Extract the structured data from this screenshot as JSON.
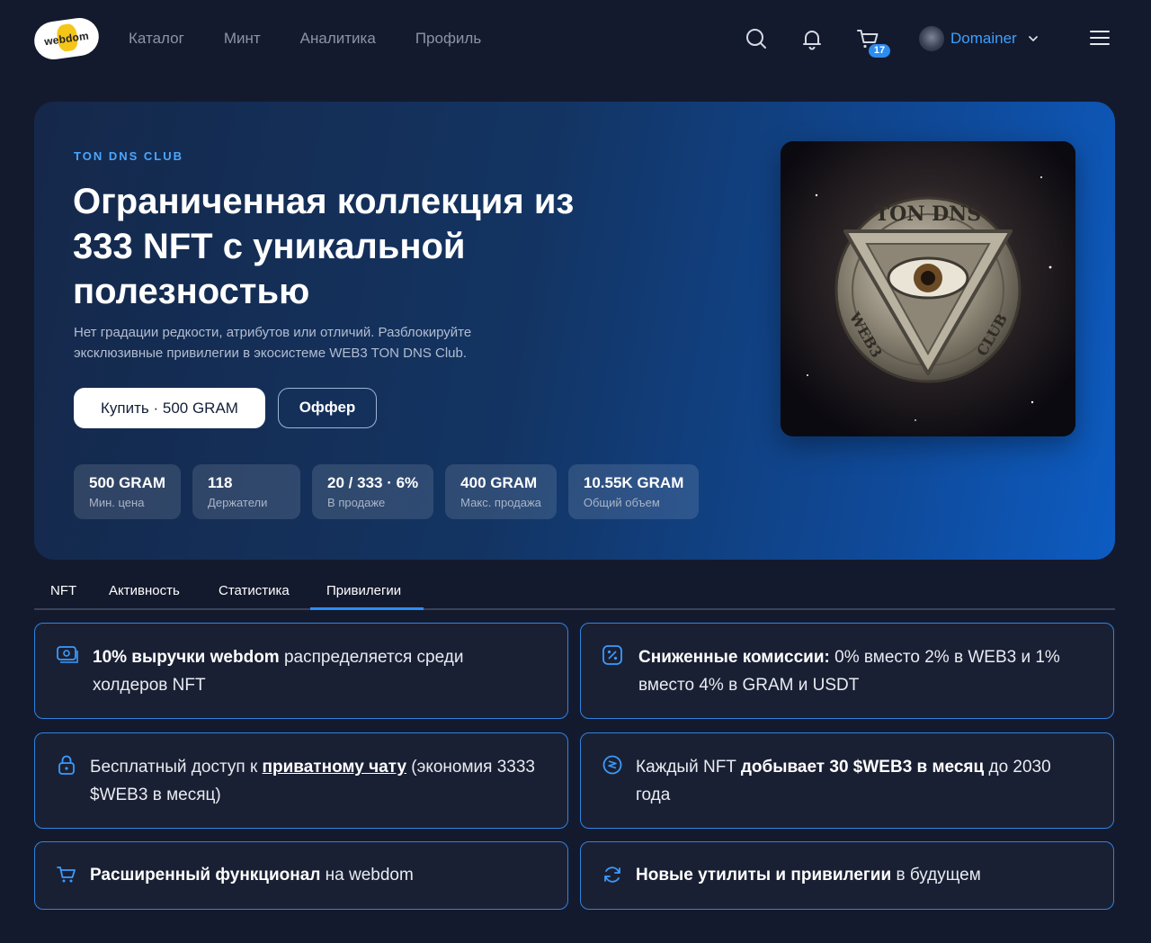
{
  "header": {
    "logo_text": "webdom",
    "nav": [
      "Каталог",
      "Минт",
      "Аналитика",
      "Профиль"
    ],
    "cart_count": "17",
    "user_name": "Domainer",
    "icons": [
      "search-icon",
      "bell-icon",
      "cart-icon",
      "chevron-down-icon",
      "menu-icon"
    ]
  },
  "hero": {
    "eyebrow": "TON DNS CLUB",
    "title": "Ограниченная коллекция из 333 NFT с уникальной полезностью",
    "subtitle": "Нет градации редкости, атрибутов или отличий. Разблокируйте эксклюзивные привилегии в экосистеме WEB3 TON DNS Club.",
    "buy_label": "Купить · 500 GRAM",
    "offer_label": "Оффер",
    "image_text_top": "TON DNS",
    "image_text_left": "WEB3",
    "image_text_right": "CLUB",
    "stats": [
      {
        "value": "500 GRAM",
        "label": "Мин. цена"
      },
      {
        "value": "118",
        "label": "Держатели"
      },
      {
        "value": "20 / 333 · 6%",
        "label": "В продаже"
      },
      {
        "value": "400 GRAM",
        "label": "Макс. продажа"
      },
      {
        "value": "10.55K GRAM",
        "label": "Общий объем"
      }
    ]
  },
  "tabs": [
    "NFT",
    "Активность",
    "Статистика",
    "Привилегии"
  ],
  "active_tab": "Привилегии",
  "privileges": {
    "revenue": {
      "bold": "10% выручки webdom",
      "rest": " распределяется среди холдеров NFT",
      "icon": "money-icon"
    },
    "fees": {
      "bold": "Сниженные комиссии:",
      "rest": " 0% вместо 2% в WEB3 и 1% вместо 4% в GRAM и USDT",
      "icon": "percent-icon"
    },
    "chat": {
      "pre": "Бесплатный доступ к ",
      "link": "приватному чату",
      "rest": " (экономия 3333 $WEB3 в месяц)",
      "icon": "lock-icon"
    },
    "mining": {
      "pre": "Каждый NFT ",
      "bold": "добывает 30 $WEB3 в месяц",
      "rest": " до 2030 года",
      "icon": "coin-icon"
    },
    "features": {
      "bold": "Расширенный функционал",
      "rest": " на webdom",
      "icon": "cart-icon"
    },
    "future": {
      "bold": "Новые утилиты и привилегии",
      "rest": " в будущем",
      "icon": "refresh-icon"
    }
  },
  "colors": {
    "background": "#141a2d",
    "accent": "#2b8ef7",
    "user_name": "#3aa0ff",
    "eyebrow": "#4aa7ff"
  }
}
